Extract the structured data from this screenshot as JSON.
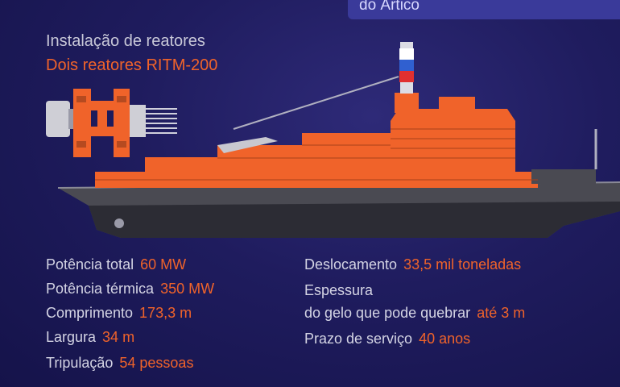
{
  "header": {
    "text": "do Ártico"
  },
  "reactor": {
    "title": "Instalação de reatores",
    "subtitle": "Dois reatores RITM-200"
  },
  "specs_left": [
    {
      "label": "Potência total",
      "value": "60 MW"
    },
    {
      "label": "Potência térmica",
      "value": "350 MW"
    },
    {
      "label": "Comprimento",
      "value": "173,3 m"
    },
    {
      "label": "Largura",
      "value": "34 m"
    },
    {
      "label": "Tripulação",
      "value": "54 pessoas"
    }
  ],
  "specs_right": {
    "displacement": {
      "label": "Deslocamento",
      "value": "33,5 mil toneladas"
    },
    "ice_label_1": "Espessura",
    "ice": {
      "label": "do gelo que pode quebrar",
      "value": "até 3 m"
    },
    "service": {
      "label": "Prazo de serviço",
      "value": "40 anos"
    }
  },
  "colors": {
    "accent": "#f0632a",
    "background": "#1f1c5e",
    "hull": "#4a4a52"
  }
}
